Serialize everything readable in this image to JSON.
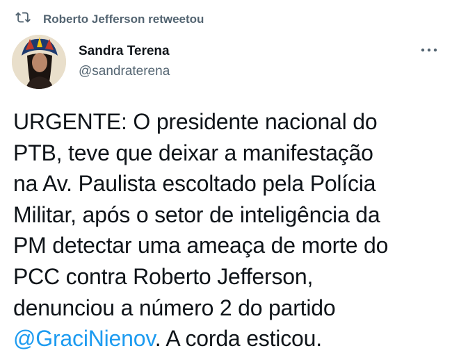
{
  "retweet": {
    "icon": "retweet-icon",
    "text": "Roberto Jefferson retweetou"
  },
  "author": {
    "name": "Sandra Terena",
    "handle": "@sandraterena",
    "avatar_icon": "avatar"
  },
  "menu": {
    "icon": "more-options-icon"
  },
  "tweet": {
    "lines": [
      "URGENTE: O presidente nacional do",
      "PTB, teve que deixar a manifestação",
      "na Av. Paulista escoltado pela Polícia",
      "Militar, após o setor de inteligência da",
      "PM detectar uma ameaça de morte do",
      "PCC contra Roberto Jefferson,",
      "denunciou a número 2 do partido"
    ],
    "mention": "@GraciNienov",
    "last_line_rest": ". A corda esticou."
  },
  "colors": {
    "link": "#1d9bf0",
    "secondary_text": "#536471",
    "primary_text": "#0f1419"
  }
}
